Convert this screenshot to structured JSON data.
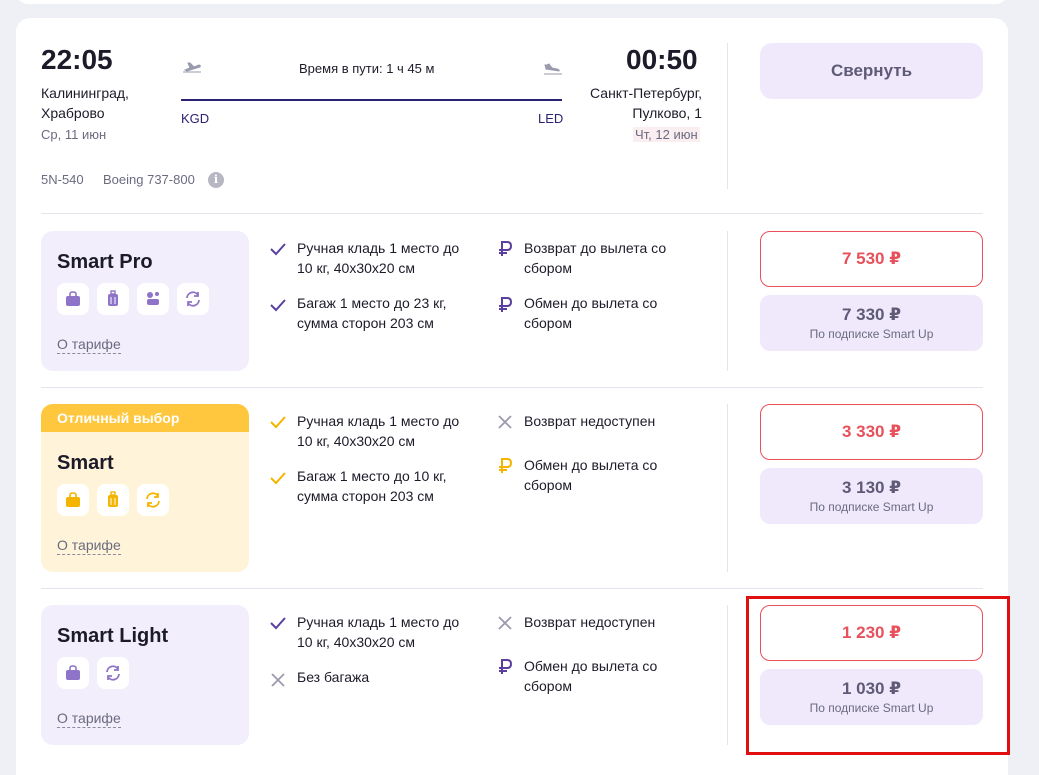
{
  "flight": {
    "dep_time": "22:05",
    "dep_city_1": "Калининград,",
    "dep_city_2": "Храброво",
    "dep_date": "Ср, 11 июн",
    "duration": "Время в пути: 1 ч 45 м",
    "dep_code": "KGD",
    "arr_code": "LED",
    "arr_time": "00:50",
    "arr_city_1": "Санкт-Петербург,",
    "arr_city_2": "Пулково, 1",
    "arr_date": "Чт, 12 июн",
    "flight_no": "5N-540",
    "aircraft": "Boeing 737-800",
    "collapse_label": "Свернуть"
  },
  "colors": {
    "accent": "#2b2270",
    "price_red": "#e8505b",
    "violet_bg": "#f3eefc",
    "yellow_bg": "#fff4d9",
    "badge_yellow": "#ffc73d",
    "highlight": "#e01010"
  },
  "tariffs": [
    {
      "name": "Smart Pro",
      "badge": "",
      "icons": [
        "handbag-icon",
        "suitcase-icon",
        "seat-icon",
        "exchange-icon"
      ],
      "about": "О тарифе",
      "features_left": [
        "Ручная кладь 1 место до 10 кг, 40x30x20 см",
        "Багаж 1 место до 23 кг, сумма сторон 203 см"
      ],
      "features_right": [
        "Возврат до вылета со сбором",
        "Обмен до вылета со сбором"
      ],
      "price": "7 530 ₽",
      "sub_price": "7 330 ₽",
      "sub_label": "По подписке Smart Up"
    },
    {
      "name": "Smart",
      "badge": "Отличный выбор",
      "icons": [
        "handbag-icon",
        "suitcase-icon",
        "exchange-icon"
      ],
      "about": "О тарифе",
      "features_left": [
        "Ручная кладь 1 место до 10 кг, 40x30x20 см",
        "Багаж 1 место до 10 кг, сумма сторон 203 см"
      ],
      "features_right": [
        "Возврат недоступен",
        "Обмен до вылета со сбором"
      ],
      "price": "3 330 ₽",
      "sub_price": "3 130 ₽",
      "sub_label": "По подписке Smart Up"
    },
    {
      "name": "Smart Light",
      "badge": "",
      "icons": [
        "handbag-icon",
        "exchange-icon"
      ],
      "about": "О тарифе",
      "features_left": [
        "Ручная кладь 1 место до 10 кг, 40x30x20 см",
        "Без багажа"
      ],
      "features_right": [
        "Возврат недоступен",
        "Обмен до вылета со сбором"
      ],
      "price": "1 230 ₽",
      "sub_price": "1 030 ₽",
      "sub_label": "По подписке Smart Up"
    }
  ]
}
